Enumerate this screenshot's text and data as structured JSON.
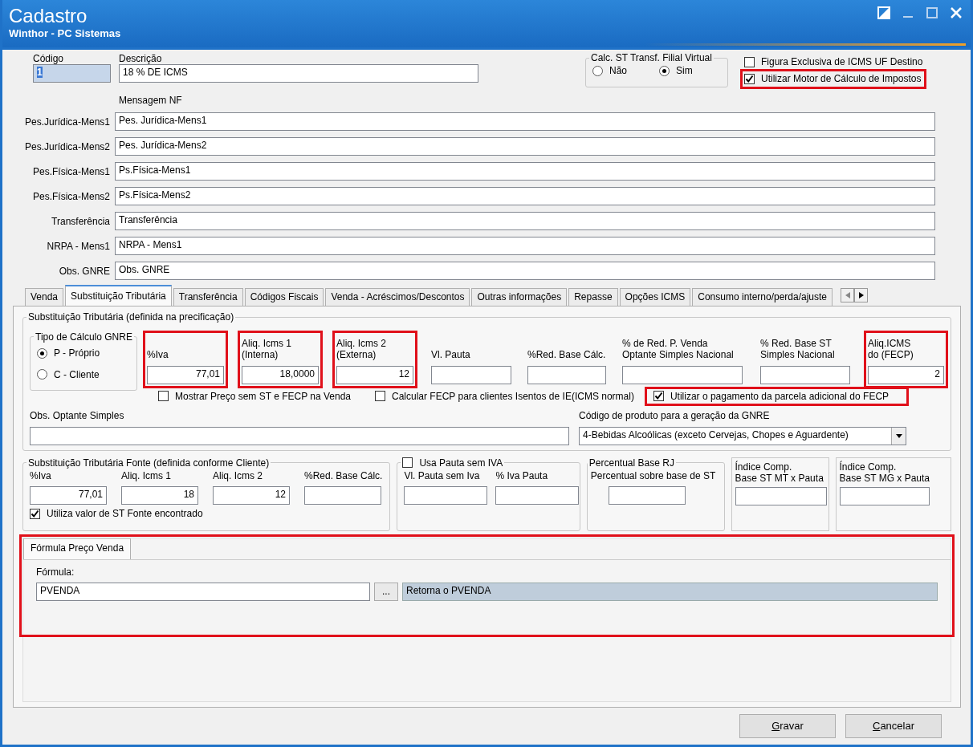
{
  "window": {
    "title": "Cadastro",
    "subtitle": "Winthor - PC Sistemas"
  },
  "header": {
    "codigo": {
      "label": "Código",
      "value": "1"
    },
    "descricao": {
      "label": "Descrição",
      "value": "18 % DE ICMS"
    },
    "calc_st": {
      "legend": "Calc. ST Transf. Filial Virtual",
      "options": [
        {
          "label": "Não",
          "selected": false
        },
        {
          "label": "Sim",
          "selected": true
        }
      ]
    },
    "checks": [
      {
        "label": "Figura Exclusiva de ICMS UF Destino",
        "checked": false
      },
      {
        "label": "Utilizar Motor de Cálculo de Impostos",
        "checked": true,
        "highlighted": true
      }
    ]
  },
  "mensagem_nf": {
    "label": "Mensagem NF",
    "rows": [
      {
        "label": "Pes.Jurídica-Mens1",
        "value": "Pes. Jurídica-Mens1"
      },
      {
        "label": "Pes.Jurídica-Mens2",
        "value": "Pes. Jurídica-Mens2"
      },
      {
        "label": "Pes.Física-Mens1",
        "value": "Ps.Física-Mens1"
      },
      {
        "label": "Pes.Física-Mens2",
        "value": "Ps.Física-Mens2"
      },
      {
        "label": "Transferência",
        "value": "Transferência"
      },
      {
        "label": "NRPA - Mens1",
        "value": "NRPA - Mens1"
      },
      {
        "label": "Obs. GNRE",
        "value": "Obs. GNRE"
      }
    ]
  },
  "tabs": [
    {
      "label": "Venda",
      "selected": false
    },
    {
      "label": "Substituição Tributária",
      "selected": true
    },
    {
      "label": "Transferência",
      "selected": false
    },
    {
      "label": "Códigos Fiscais",
      "selected": false
    },
    {
      "label": "Venda - Acréscimos/Descontos",
      "selected": false
    },
    {
      "label": "Outras informações",
      "selected": false
    },
    {
      "label": "Repasse",
      "selected": false
    },
    {
      "label": "Opções ICMS",
      "selected": false
    },
    {
      "label": "Consumo interno/perda/ajuste",
      "selected": false
    }
  ],
  "st_group": {
    "legend": "Substituição Tributária (definida na precificação)",
    "gnre": {
      "legend": "Tipo de Cálculo GNRE",
      "options": [
        {
          "label": "P - Próprio",
          "selected": true
        },
        {
          "label": "C - Cliente",
          "selected": false
        }
      ]
    },
    "fields": [
      {
        "label": "%Iva",
        "value": "77,01",
        "highlighted": true
      },
      {
        "label": "Aliq. Icms 1\n(Interna)",
        "value": "18,0000",
        "highlighted": true
      },
      {
        "label": "Aliq. Icms 2\n(Externa)",
        "value": "12",
        "highlighted": true
      },
      {
        "label": "Vl. Pauta"
      },
      {
        "label": "%Red. Base Cálc."
      },
      {
        "label": "% de Red. P. Venda\nOptante Simples Nacional"
      },
      {
        "label": "% Red. Base ST\nSimples Nacional"
      },
      {
        "label": "Aliq.ICMS\ndo (FECP)",
        "value": "2",
        "highlighted": true
      }
    ],
    "checks": [
      {
        "label": "Mostrar Preço sem ST e FECP na Venda",
        "checked": false
      },
      {
        "label": "Calcular FECP para clientes Isentos de IE(ICMS normal)",
        "checked": false
      },
      {
        "label": "Utilizar o pagamento da parcela adicional do FECP",
        "checked": true,
        "highlighted": true
      }
    ],
    "obs": {
      "label": "Obs. Optante Simples"
    },
    "codigo_produto": {
      "label": "Código de produto para a geração da GNRE",
      "value": "4-Bebidas Alcoólicas (exceto Cervejas, Chopes e Aguardente)"
    }
  },
  "fonte_group": {
    "legend": "Substituição Tributária Fonte (definida conforme Cliente)",
    "fields": [
      {
        "label": "%Iva",
        "value": "77,01"
      },
      {
        "label": "Aliq. Icms 1",
        "value": "18"
      },
      {
        "label": "Aliq. Icms 2",
        "value": "12"
      },
      {
        "label": "%Red. Base Cálc."
      }
    ],
    "check": {
      "label": "Utiliza valor de ST Fonte encontrado",
      "checked": true
    }
  },
  "pauta_group": {
    "legend": "Usa Pauta sem IVA",
    "checked": false,
    "fields": [
      {
        "label": "Vl. Pauta sem Iva"
      },
      {
        "label": "% Iva Pauta"
      }
    ]
  },
  "rj_group": {
    "legend": "Percentual Base RJ",
    "fields": [
      {
        "label": "Percentual sobre base de ST"
      }
    ]
  },
  "indices": [
    {
      "label": "Índice Comp.\nBase ST MT x Pauta"
    },
    {
      "label": "Índice Comp.\nBase ST MG x Pauta"
    }
  ],
  "formula": {
    "highlighted": true,
    "tabs": [
      {
        "label": "Fórmula Preço Venda",
        "selected": true
      }
    ],
    "label": "Fórmula:",
    "value": "PVENDA",
    "button": "...",
    "description": "Retorna o PVENDA"
  },
  "buttons": [
    {
      "label": "Gravar"
    },
    {
      "label": "Cancelar"
    }
  ]
}
